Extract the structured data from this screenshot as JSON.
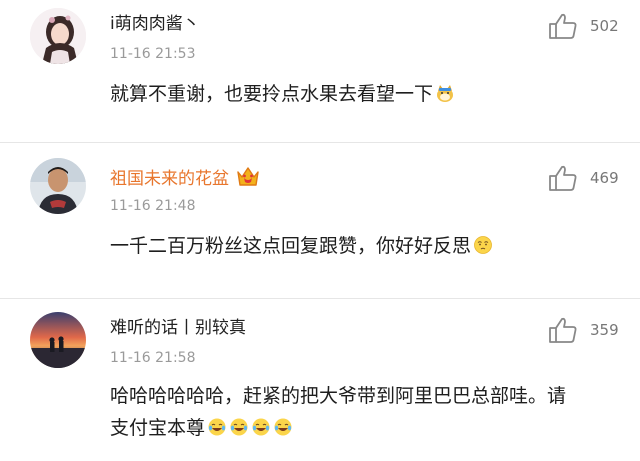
{
  "comments": [
    {
      "username": "i萌肉肉酱丶",
      "timestamp": "11-16 21:53",
      "likes": "502",
      "text": "就算不重谢，也要拎点水果去看望一下",
      "avatar": "girl-illustration-avatar",
      "trailing_emoji": "doge-emoji"
    },
    {
      "username": "祖国未来的花盆",
      "timestamp": "11-16 21:48",
      "likes": "469",
      "text": "一千二百万粉丝这点回复跟赞，你好好反思",
      "avatar": "man-photo-avatar",
      "badge": "vip-crown-icon",
      "trailing_emoji": "thinking-emoji"
    },
    {
      "username": "难听的话丨别较真",
      "timestamp": "11-16 21:58",
      "likes": "359",
      "text_line1": "哈哈哈哈哈哈，赶紧的把大爷带到阿里巴巴总部哇。请",
      "text_line2": "支付宝本尊",
      "avatar": "sunset-couple-avatar",
      "trailing_emoji": "laughing-emoji"
    }
  ],
  "colors": {
    "vip_name": "#e8762d",
    "timestamp": "#9a9a9a",
    "divider": "#e6e6e6"
  }
}
